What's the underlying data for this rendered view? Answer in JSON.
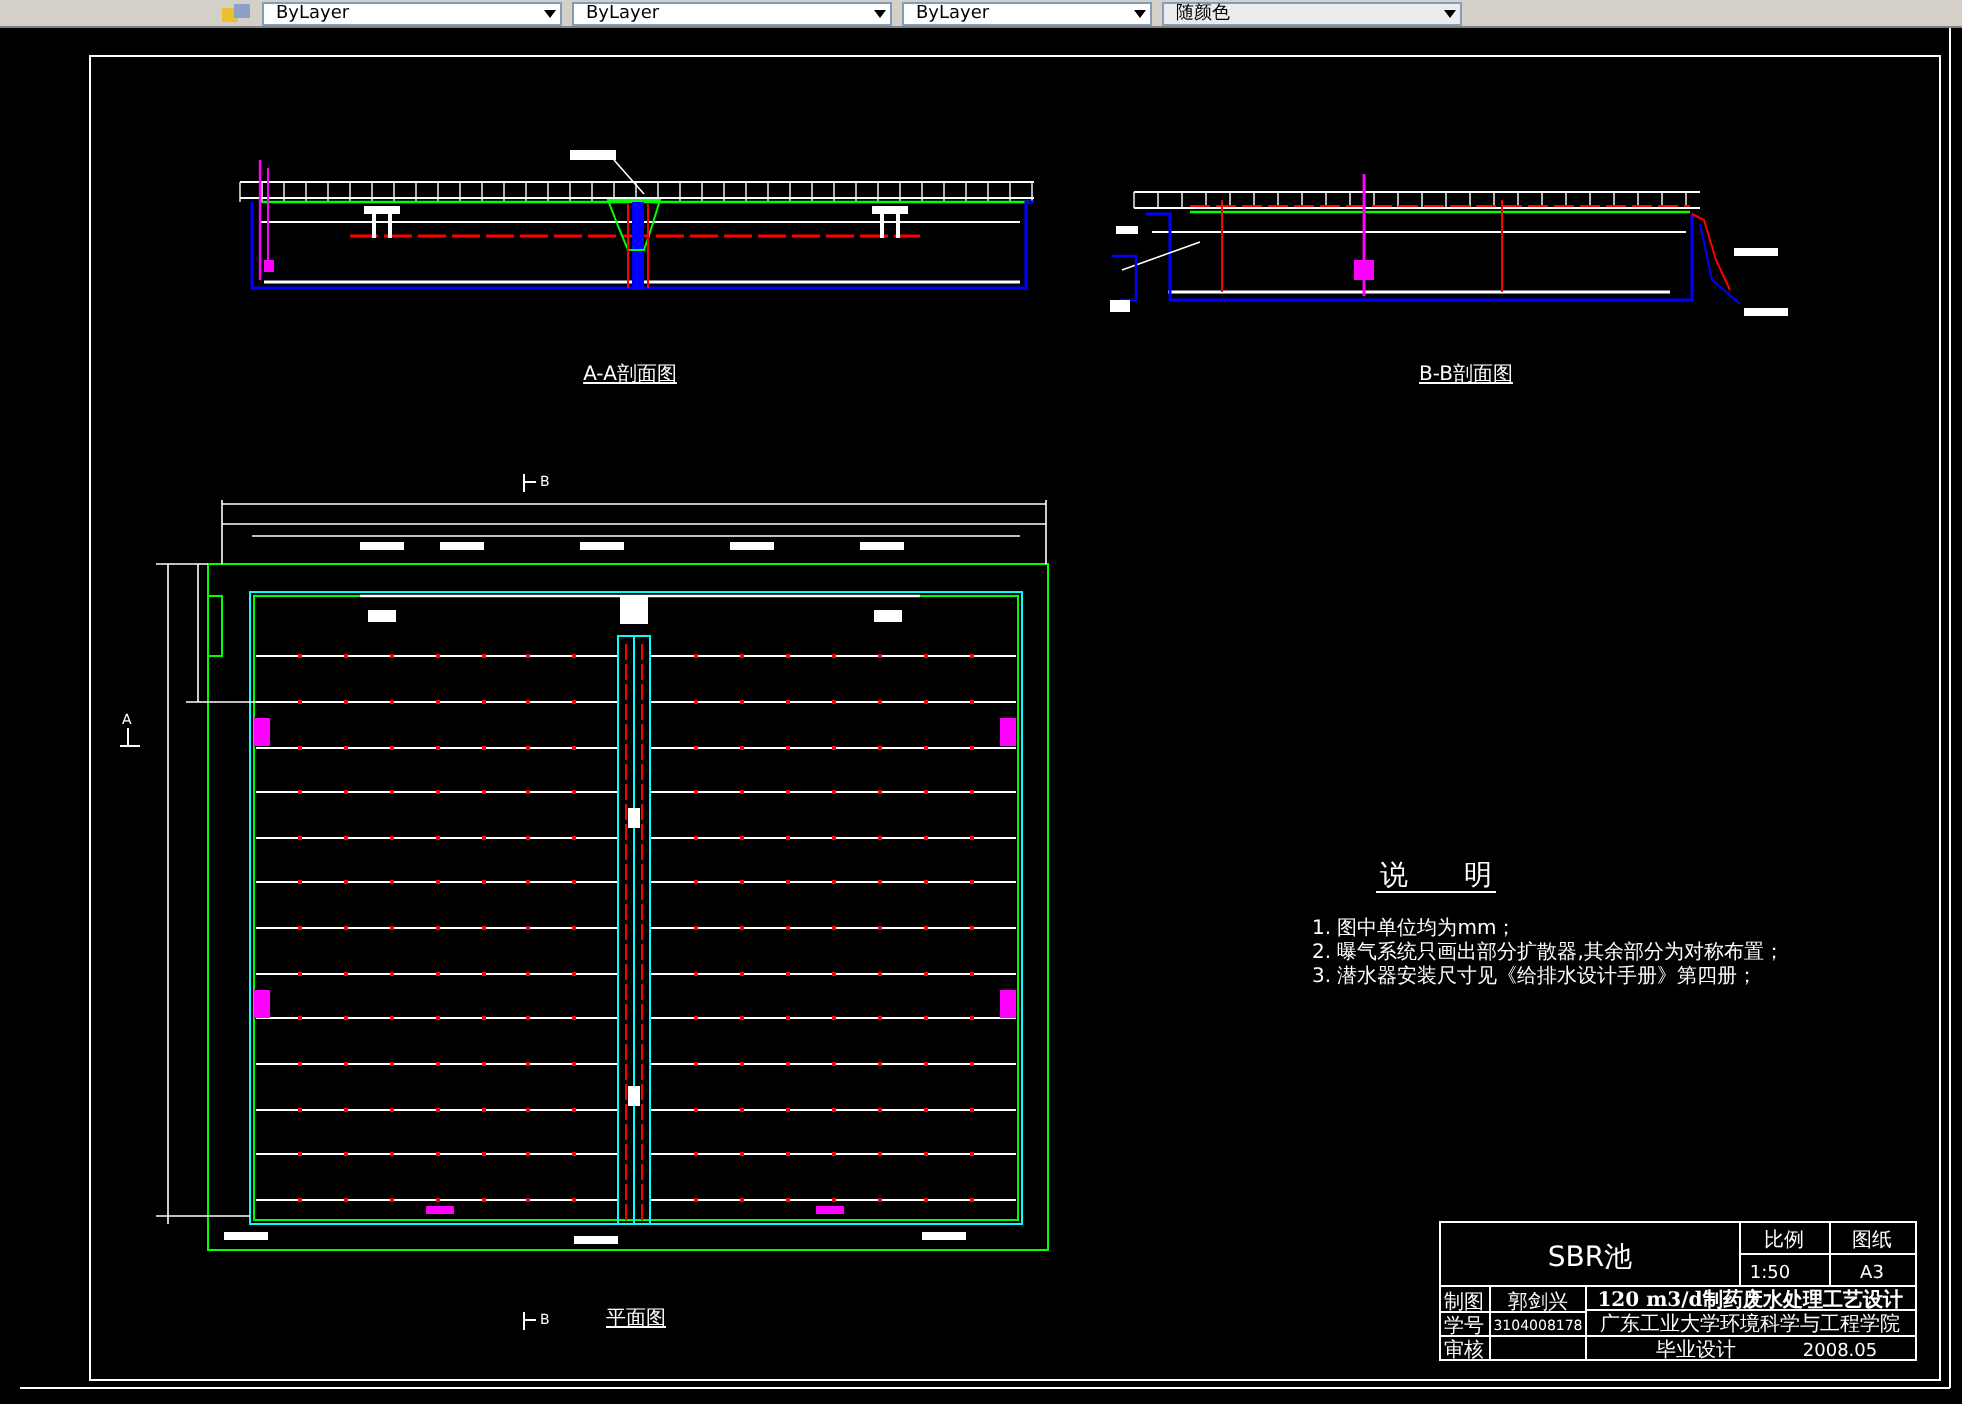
{
  "toolbar": {
    "dropdowns": [
      {
        "value": "ByLayer"
      },
      {
        "value": "ByLayer"
      },
      {
        "value": "ByLayer"
      },
      {
        "value": "随颜色"
      }
    ]
  },
  "drawing": {
    "views": [
      {
        "kind": "aa_section",
        "title": "A-A剖面图"
      },
      {
        "kind": "bb_section",
        "title": "B-B剖面图"
      },
      {
        "kind": "plan",
        "title": "平面图"
      }
    ],
    "section_marks": [
      {
        "label": "B"
      },
      {
        "label": "A"
      },
      {
        "label": "B"
      }
    ]
  },
  "notes": {
    "heading": "说　　明",
    "items": [
      "1. 图中单位均为mm；",
      "2. 曝气系统只画出部分扩散器,其余部分为对称布置；",
      "3. 潜水器安装尺寸见《给排水设计手册》第四册；"
    ]
  },
  "title_block": {
    "drawing_name": "SBR池",
    "scale_label": "比例",
    "scale": "1:50",
    "sheet_label": "图纸",
    "sheet": "A3",
    "drawn_by_label": "制图",
    "drawn_by": "郭剑兴",
    "student_no_label": "学号",
    "student_no": "3104008178",
    "checked_by_label": "审核",
    "project": "120 m3/d制药废水处理工艺设计",
    "school": "广东工业大学环境科学与工程学院",
    "thesis": "毕业设计",
    "date": "2008.05"
  }
}
